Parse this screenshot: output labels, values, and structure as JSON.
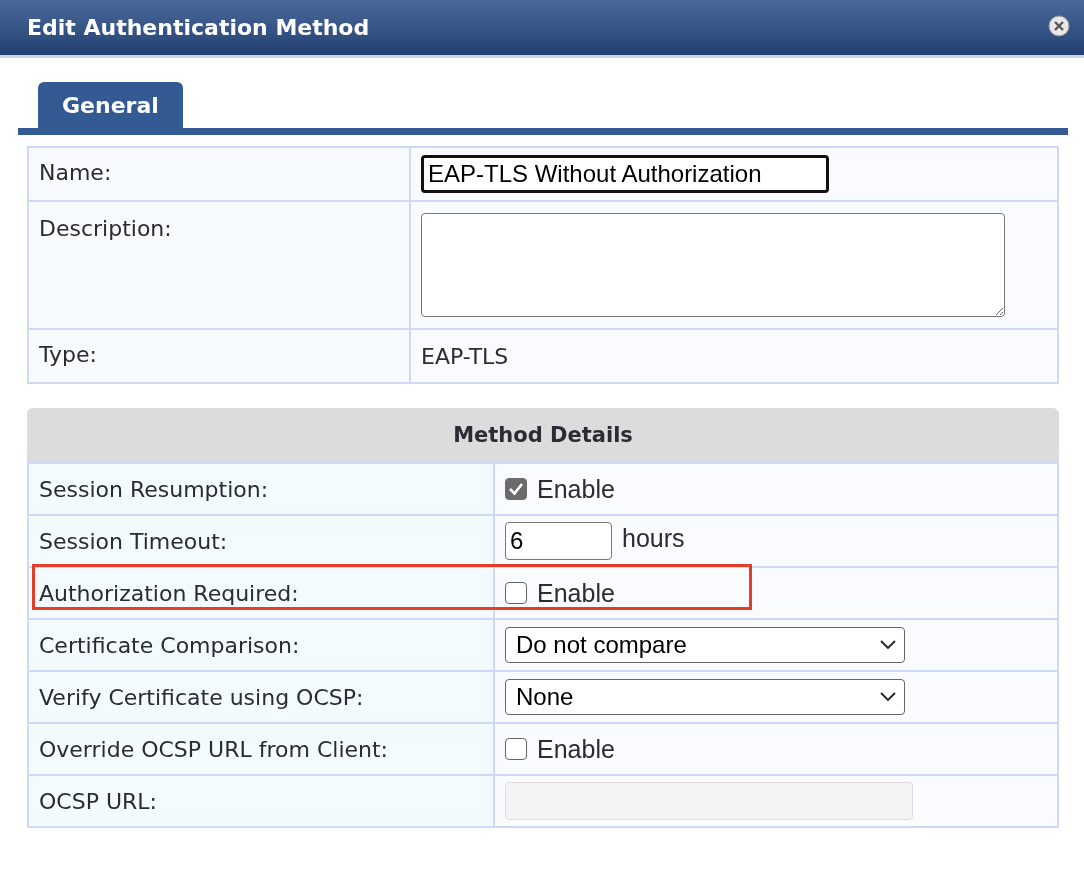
{
  "window": {
    "title": "Edit Authentication Method"
  },
  "tabs": [
    {
      "label": "General",
      "selected": true
    }
  ],
  "general": [
    {
      "label": "Name:",
      "kind": "input",
      "value": "EAP-TLS Without Authorization",
      "focused": true
    },
    {
      "label": "Description:",
      "kind": "textarea"
    },
    {
      "label": "Type:",
      "kind": "text",
      "value": "EAP-TLS"
    }
  ],
  "method_details": {
    "title": "Method Details",
    "rows": [
      {
        "label": "Session Resumption:",
        "kind": "checkbox",
        "checked": true,
        "option": "Enable",
        "highlighted": false
      },
      {
        "label": "Session Timeout:",
        "kind": "number",
        "value": "6",
        "unit": "hours",
        "highlighted": false
      },
      {
        "label": "Authorization Required:",
        "kind": "checkbox",
        "checked": false,
        "option": "Enable",
        "highlighted": true
      },
      {
        "label": "Certificate Comparison:",
        "kind": "select",
        "value": "Do not compare",
        "highlighted": false
      },
      {
        "label": "Verify Certificate using OCSP:",
        "kind": "select",
        "value": "None",
        "highlighted": false
      },
      {
        "label": "Override OCSP URL from Client:",
        "kind": "checkbox",
        "checked": false,
        "option": "Enable",
        "highlighted": false
      },
      {
        "label": "OCSP URL:",
        "kind": "field",
        "disabled": true,
        "highlighted": false
      }
    ]
  }
}
